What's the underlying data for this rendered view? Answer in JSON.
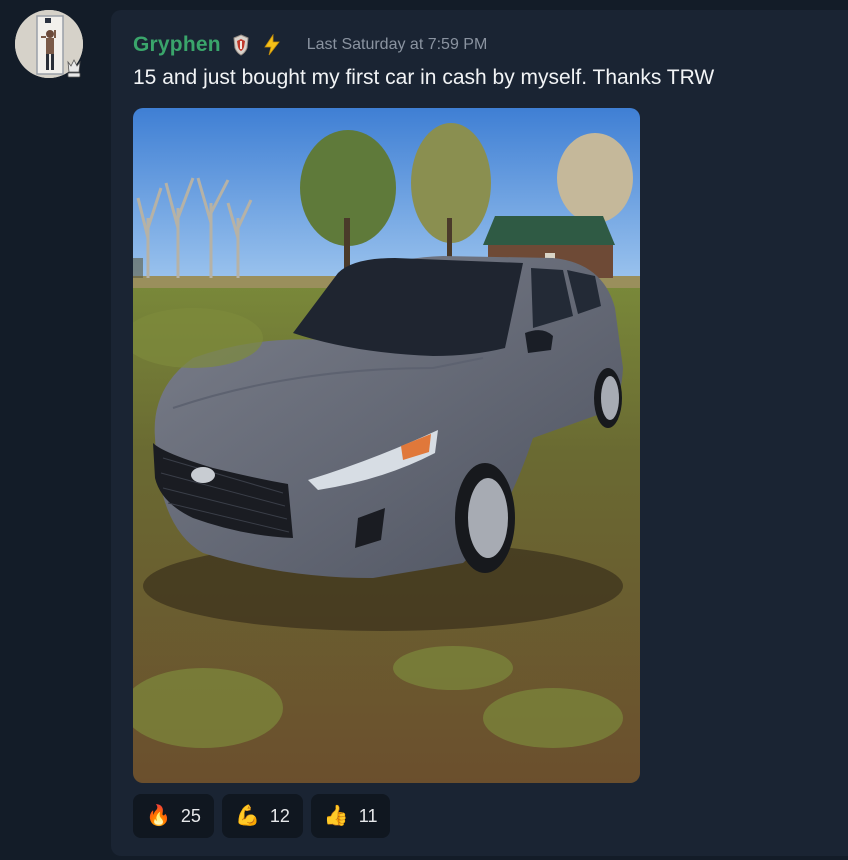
{
  "message": {
    "author": "Gryphen",
    "timestamp": "Last Saturday at 7:59 PM",
    "text": "15 and just bought my first car in cash by myself. Thanks TRW",
    "icons": [
      "shield-badge-icon",
      "lightning-bolt-icon"
    ]
  },
  "attachment": {
    "type": "photo",
    "icon": "car-photo"
  },
  "reactions": [
    {
      "emoji": "🔥",
      "count": "25",
      "icon": "fire-emoji"
    },
    {
      "emoji": "💪",
      "count": "12",
      "icon": "flexed-biceps-emoji"
    },
    {
      "emoji": "👍",
      "count": "11",
      "icon": "thumbs-up-emoji"
    }
  ],
  "colors": {
    "background": "#131c28",
    "card": "#1a2433",
    "username": "#3aa56b",
    "timestamp": "#8a93a0"
  }
}
